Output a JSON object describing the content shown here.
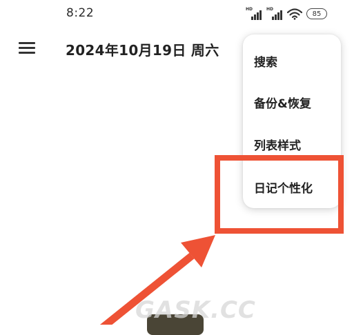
{
  "status_bar": {
    "time": "8:22",
    "signal_label": "HD",
    "battery": "85"
  },
  "header": {
    "title": "2024年10月19日 周六"
  },
  "popup_menu": {
    "items": [
      {
        "label": "搜索"
      },
      {
        "label": "备份&恢复"
      },
      {
        "label": "列表样式"
      },
      {
        "label": "日记个性化"
      }
    ]
  },
  "annotation": {
    "highlight_color": "#ee5235",
    "arrow_color": "#ee5235"
  },
  "watermark": "GASK.CC",
  "colors": {
    "background": "#ffffff",
    "text": "#222222"
  }
}
